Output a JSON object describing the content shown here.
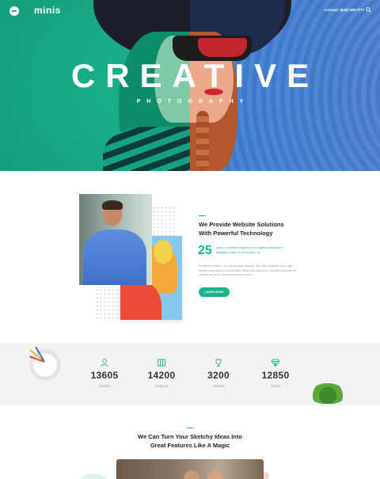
{
  "header": {
    "brand": "minis",
    "contact": "Contact: (843) 308-7777"
  },
  "hero": {
    "title": "CREATIVE",
    "subtitle": "PHOTOGRAPHY"
  },
  "about": {
    "heading_line1": "We Provide Website Solutions",
    "heading_line2": "With Powerful Technology",
    "years": "25",
    "years_text": "years of creative experience in digital marketing is definitely worth of your trust in us",
    "body": "Praesent sit amet, orci quis suscipit volutpat. Nec justo tincidunt risus, eget blandit nunc mauris sit amet risus. Maecenas elit lorem, suscipit in laoreet vel, volutpat sit amet, volutpat commodo lacus.",
    "button_label": "LEARN MORE"
  },
  "stats": [
    {
      "value": "13605",
      "label": "Clients",
      "icon": "user-icon"
    },
    {
      "value": "14200",
      "label": "Projects",
      "icon": "book-icon"
    },
    {
      "value": "3200",
      "label": "Awards",
      "icon": "award-icon"
    },
    {
      "value": "12850",
      "label": "Praise",
      "icon": "diamond-icon"
    }
  ],
  "features": {
    "heading_line1": "We Can Turn Your  Sketchy Ideas Into",
    "heading_line2": "Great Features Like A Magic"
  },
  "colors": {
    "accent": "#17b48c",
    "hero_left": "#17b48c",
    "hero_right": "#4a7fd0",
    "stats_bg": "#f3f3f3"
  }
}
